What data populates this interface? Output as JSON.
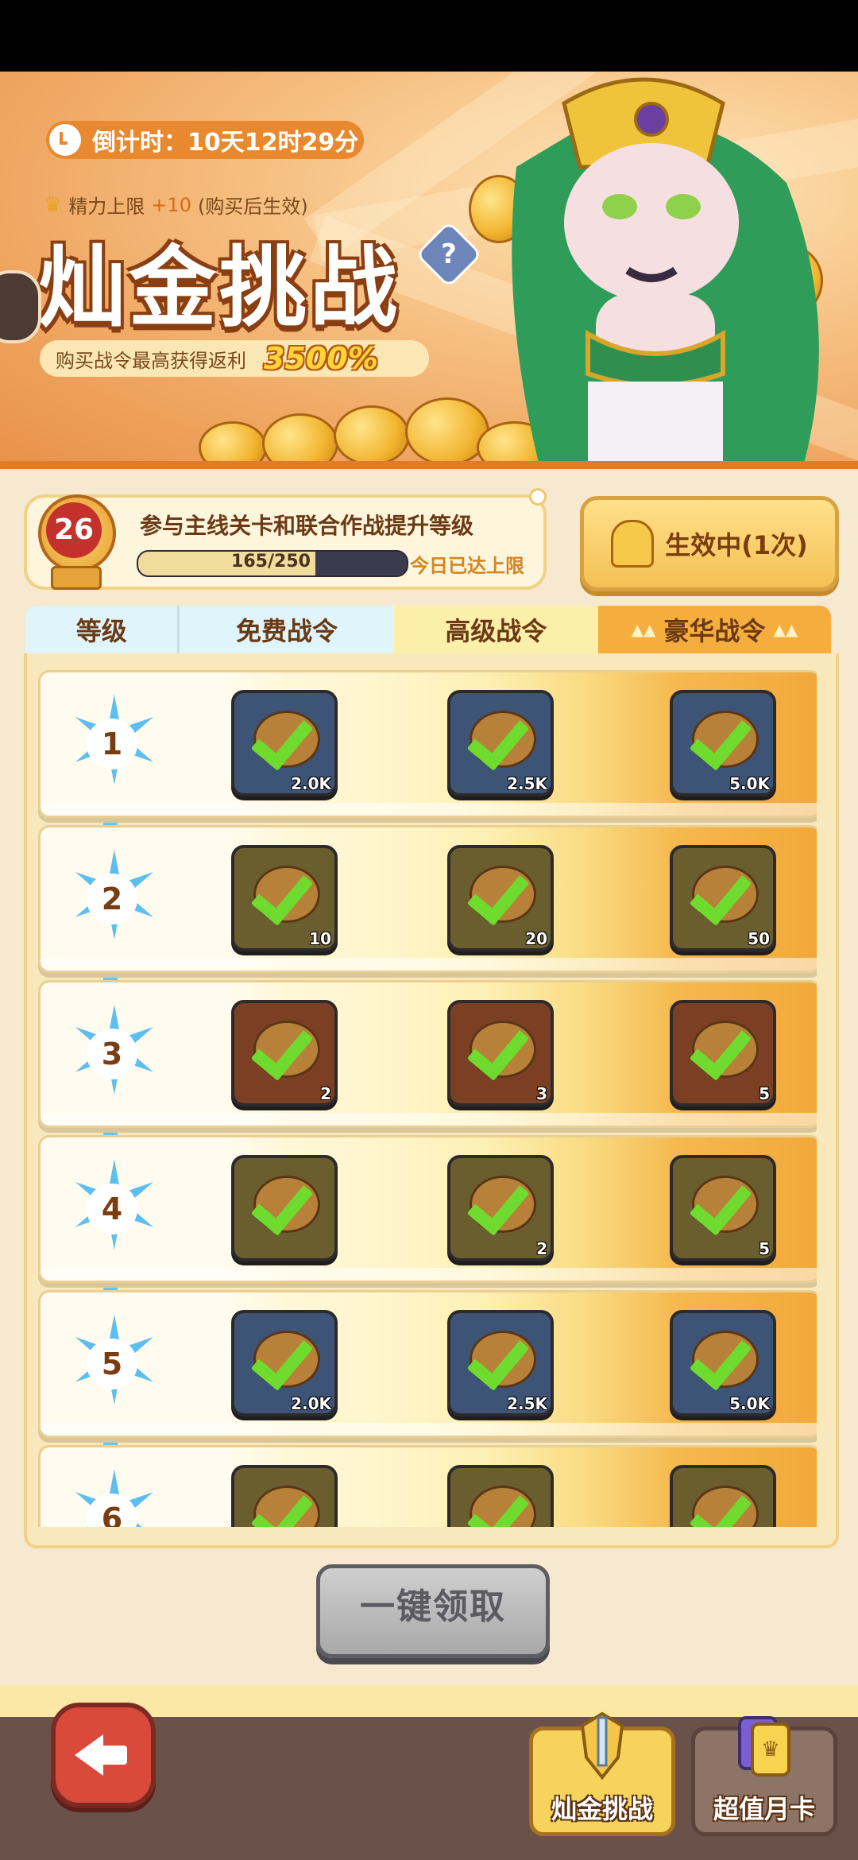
{
  "banner": {
    "countdown": "倒计时：10天12时29分",
    "energy_label": "精力上限",
    "energy_bonus": "+10",
    "energy_note": "(购买后生效)",
    "title": "灿金挑战",
    "help": "?",
    "subtitle": "购买战令最高获得返利",
    "percent": "3500%"
  },
  "level": {
    "number": "26",
    "description": "参与主线关卡和联合作战提升等级",
    "xp_text": "165/250",
    "xp_progress": 0.66,
    "limit_text": "今日已达上限",
    "active_label": "生效中(1次)"
  },
  "tabs": {
    "level": "等级",
    "free": "免费战令",
    "premium": "高级战令",
    "luxury": "豪华战令"
  },
  "rows": [
    {
      "level": "1",
      "items": [
        {
          "kind": "blue",
          "qty": "2.0K"
        },
        {
          "kind": "blue",
          "qty": "2.5K"
        },
        {
          "kind": "blue",
          "qty": "5.0K"
        }
      ]
    },
    {
      "level": "2",
      "items": [
        {
          "kind": "olive",
          "qty": "10"
        },
        {
          "kind": "olive",
          "qty": "20"
        },
        {
          "kind": "olive",
          "qty": "50"
        }
      ]
    },
    {
      "level": "3",
      "items": [
        {
          "kind": "brown",
          "qty": "2"
        },
        {
          "kind": "brown",
          "qty": "3"
        },
        {
          "kind": "brown",
          "qty": "5"
        }
      ]
    },
    {
      "level": "4",
      "items": [
        {
          "kind": "olive",
          "qty": ""
        },
        {
          "kind": "olive",
          "qty": "2"
        },
        {
          "kind": "olive",
          "qty": "5"
        }
      ]
    },
    {
      "level": "5",
      "items": [
        {
          "kind": "blue",
          "qty": "2.0K"
        },
        {
          "kind": "blue",
          "qty": "2.5K"
        },
        {
          "kind": "blue",
          "qty": "5.0K"
        }
      ]
    },
    {
      "level": "6",
      "items": [
        {
          "kind": "olive",
          "qty": ""
        },
        {
          "kind": "olive",
          "qty": ""
        },
        {
          "kind": "olive",
          "qty": ""
        }
      ]
    }
  ],
  "claim_all": "一键领取",
  "nav": {
    "active_tab": "灿金挑战",
    "other_tab": "超值月卡"
  },
  "colors": {
    "accent_orange": "#e8892f",
    "check_green": "#6edb2e",
    "star_blue": "#5cbff0"
  }
}
